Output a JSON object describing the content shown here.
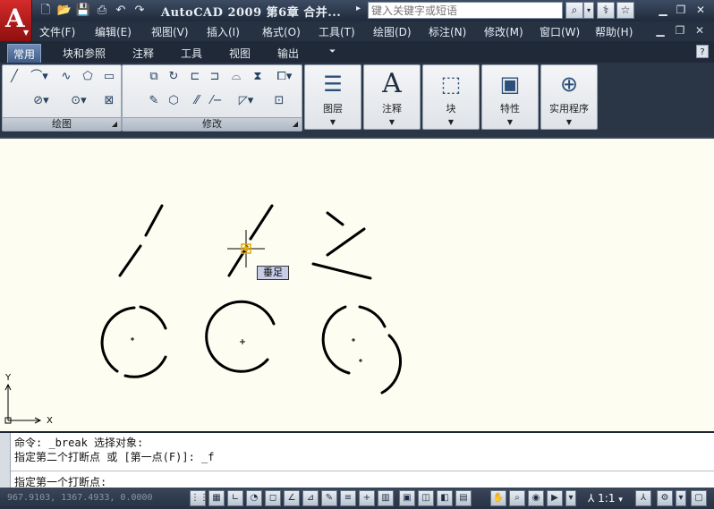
{
  "window": {
    "title": "AutoCAD 2009  第6章  合并...",
    "search_placeholder": "键入关键字或短语"
  },
  "quick_access": [
    "new-icon",
    "open-icon",
    "save-icon",
    "print-icon",
    "undo-icon",
    "redo-icon"
  ],
  "menu": [
    "文件(F)",
    "编辑(E)",
    "视图(V)",
    "插入(I)",
    "格式(O)",
    "工具(T)",
    "绘图(D)",
    "标注(N)",
    "修改(M)",
    "窗口(W)",
    "帮助(H)"
  ],
  "ribbon_tabs": [
    "常用",
    "块和参照",
    "注释",
    "工具",
    "视图",
    "输出"
  ],
  "panels": {
    "draw": "绘图",
    "modify": "修改",
    "layers": "图层",
    "annotate": "注释",
    "block": "块",
    "properties": "特性",
    "utilities": "实用程序"
  },
  "canvas": {
    "tooltip": "垂足",
    "axis_y": "Y",
    "axis_x": "X"
  },
  "command": {
    "line1": "命令: _break 选择对象:",
    "line2": "指定第二个打断点 或 [第一点(F)]: _f",
    "line3": "指定第一个打断点:"
  },
  "status": {
    "coords": "967.9103, 1367.4933, 0.0000",
    "scale": "1:1"
  },
  "colors": {
    "canvas_bg": "#fefdf1",
    "titlebar": "#2b3646",
    "logo_red": "#c62222"
  }
}
